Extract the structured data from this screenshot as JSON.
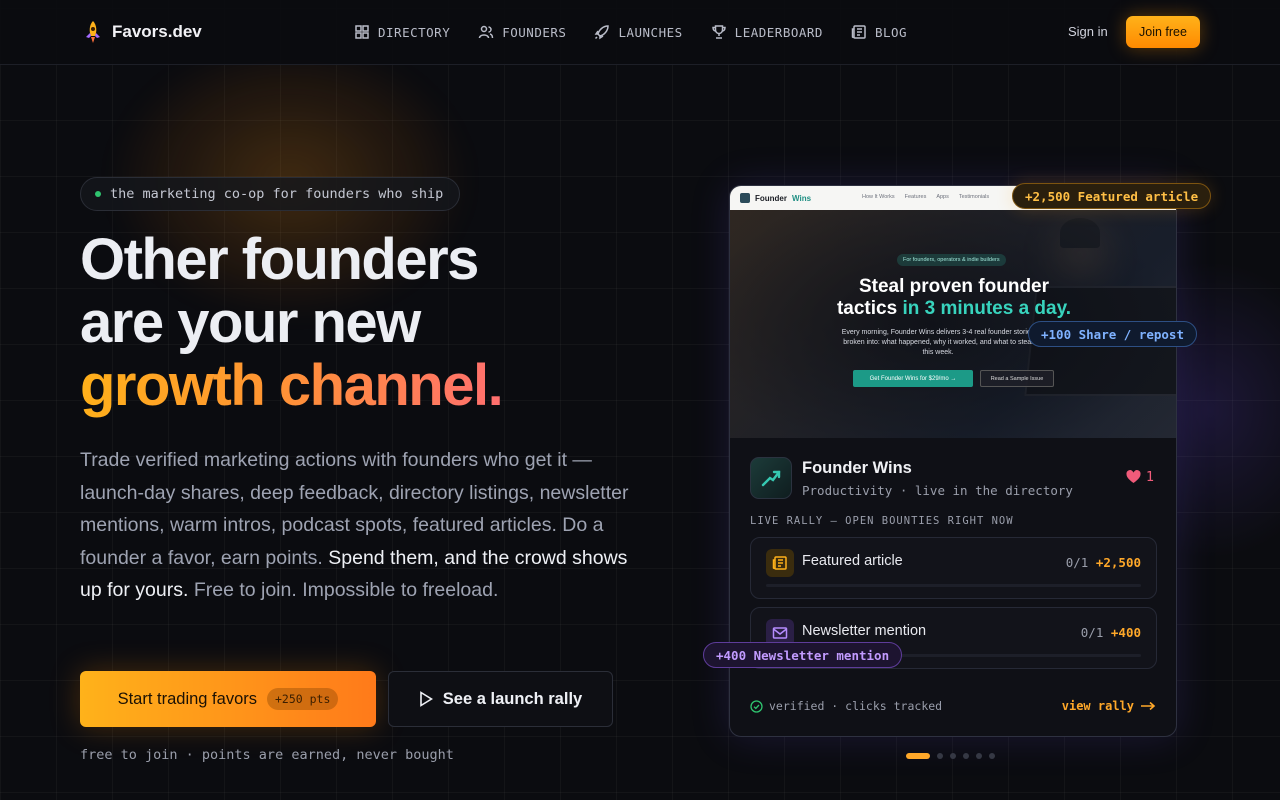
{
  "brand": {
    "name": "Favors.dev",
    "icon": "rocket-logo-icon"
  },
  "nav": {
    "links": [
      {
        "label": "DIRECTORY",
        "icon": "grid-icon"
      },
      {
        "label": "FOUNDERS",
        "icon": "users-icon"
      },
      {
        "label": "LAUNCHES",
        "icon": "rocket-icon"
      },
      {
        "label": "LEADERBOARD",
        "icon": "trophy-icon"
      },
      {
        "label": "BLOG",
        "icon": "newspaper-icon"
      }
    ],
    "signin": "Sign in",
    "join": "Join free"
  },
  "hero": {
    "tag": "the marketing co-op for founders who ship",
    "headline_line1": "Other founders",
    "headline_line2": "are your new",
    "headline_line3": "growth channel.",
    "sub_part1": "Trade verified marketing actions with founders who get it — launch-day shares, deep feedback, directory listings, newsletter mentions, warm intros, podcast spots, featured articles. Do a founder a favor, earn points.",
    "sub_part2": "Spend them, and the crowd shows up for yours.",
    "sub_part3": "Free to join. Impossible to freeload.",
    "cta_primary": "Start trading favors",
    "cta_primary_badge": "+250 pts",
    "cta_secondary": "See a launch rally",
    "footnote": "free to join · points are earned, never bought"
  },
  "card": {
    "screenshot": {
      "logo_a": "Founder",
      "logo_b": "Wins",
      "links": [
        "How It Works",
        "Features",
        "Apps",
        "Testimonials"
      ],
      "chip": "For founders, operators & indie builders",
      "h1_a": "Steal proven founder",
      "h1_b": "tactics",
      "h1_c": "in 3 minutes a day.",
      "p": "Every morning, Founder Wins delivers 3-4 real founder stories broken into: what happened, why it worked, and what to steal this week.",
      "btn1": "Get Founder Wins for $29/mo →",
      "btn2": "Read a Sample Issue"
    },
    "product": {
      "name": "Founder Wins",
      "meta": "Productivity · live in the directory",
      "likes": "1"
    },
    "rally_label": "LIVE RALLY — OPEN BOUNTIES RIGHT NOW",
    "bounties": [
      {
        "title": "Featured article",
        "count": "0/1",
        "points": "+2,500",
        "icon": "newspaper-icon",
        "progress": 0
      },
      {
        "title": "Newsletter mention",
        "count": "0/1",
        "points": "+400",
        "icon": "mail-icon",
        "progress": 0
      }
    ],
    "footer_left": "verified · clicks tracked",
    "footer_right": "view rally"
  },
  "chips": {
    "featured": "+2,500 Featured article",
    "share": "+100 Share / repost",
    "newsletter": "+400 Newsletter mention"
  },
  "carousel": {
    "count": 6,
    "active": 0
  },
  "colors": {
    "accent": "#ffa829",
    "brand_gradient_start": "#ffb21a",
    "brand_gradient_end": "#ff6f6f",
    "teal": "#38d3bd"
  }
}
